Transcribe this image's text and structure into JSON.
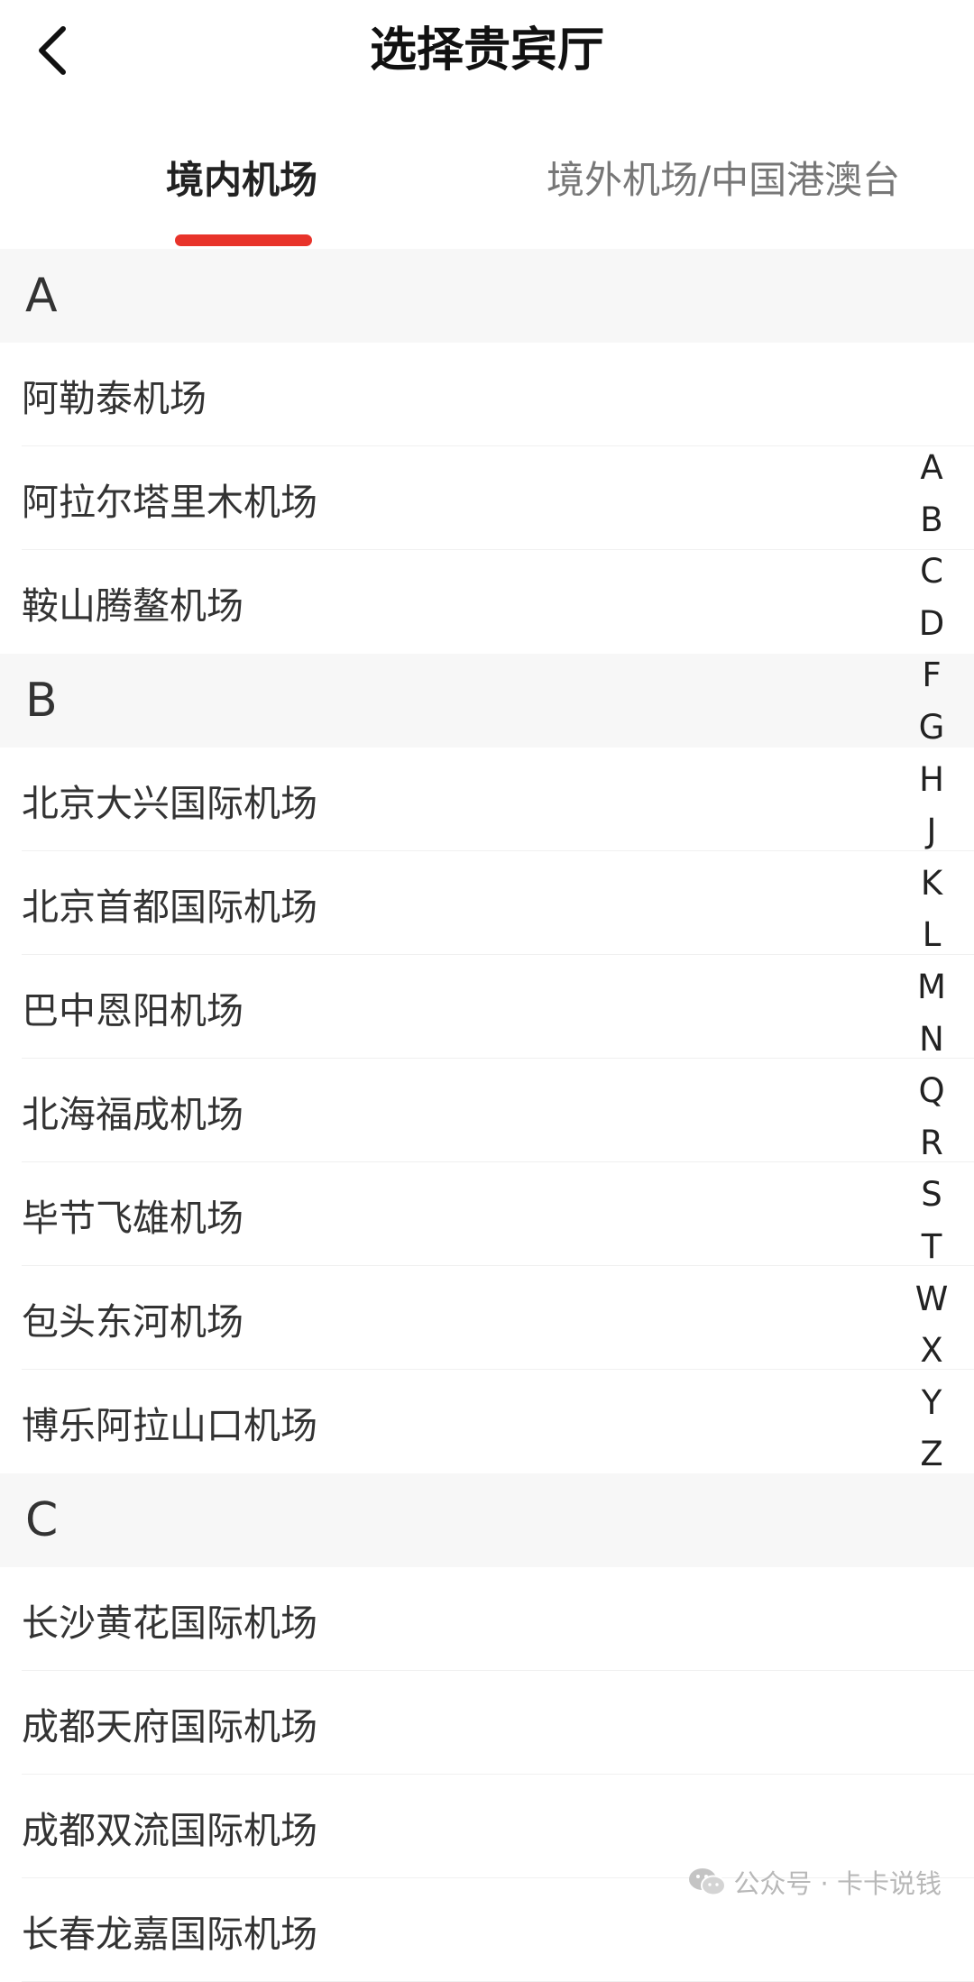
{
  "header": {
    "title": "选择贵宾厅"
  },
  "tabs": [
    {
      "label": "境内机场",
      "active": true
    },
    {
      "label": "境外机场/中国港澳台",
      "active": false
    }
  ],
  "sections": [
    {
      "letter": "A",
      "airports": [
        "阿勒泰机场",
        "阿拉尔塔里木机场",
        "鞍山腾鳌机场"
      ]
    },
    {
      "letter": "B",
      "airports": [
        "北京大兴国际机场",
        "北京首都国际机场",
        "巴中恩阳机场",
        "北海福成机场",
        "毕节飞雄机场",
        "包头东河机场",
        "博乐阿拉山口机场"
      ]
    },
    {
      "letter": "C",
      "airports": [
        "长沙黄花国际机场",
        "成都天府国际机场",
        "成都双流国际机场",
        "长春龙嘉国际机场"
      ]
    }
  ],
  "index_letters": [
    "A",
    "B",
    "C",
    "D",
    "F",
    "G",
    "H",
    "J",
    "K",
    "L",
    "M",
    "N",
    "Q",
    "R",
    "S",
    "T",
    "W",
    "X",
    "Y",
    "Z"
  ],
  "watermark": {
    "text": "公众号 · 卡卡说钱",
    "icon": "wechat-icon"
  },
  "colors": {
    "accent": "#e8332a",
    "section_bg": "#f7f7f7"
  }
}
